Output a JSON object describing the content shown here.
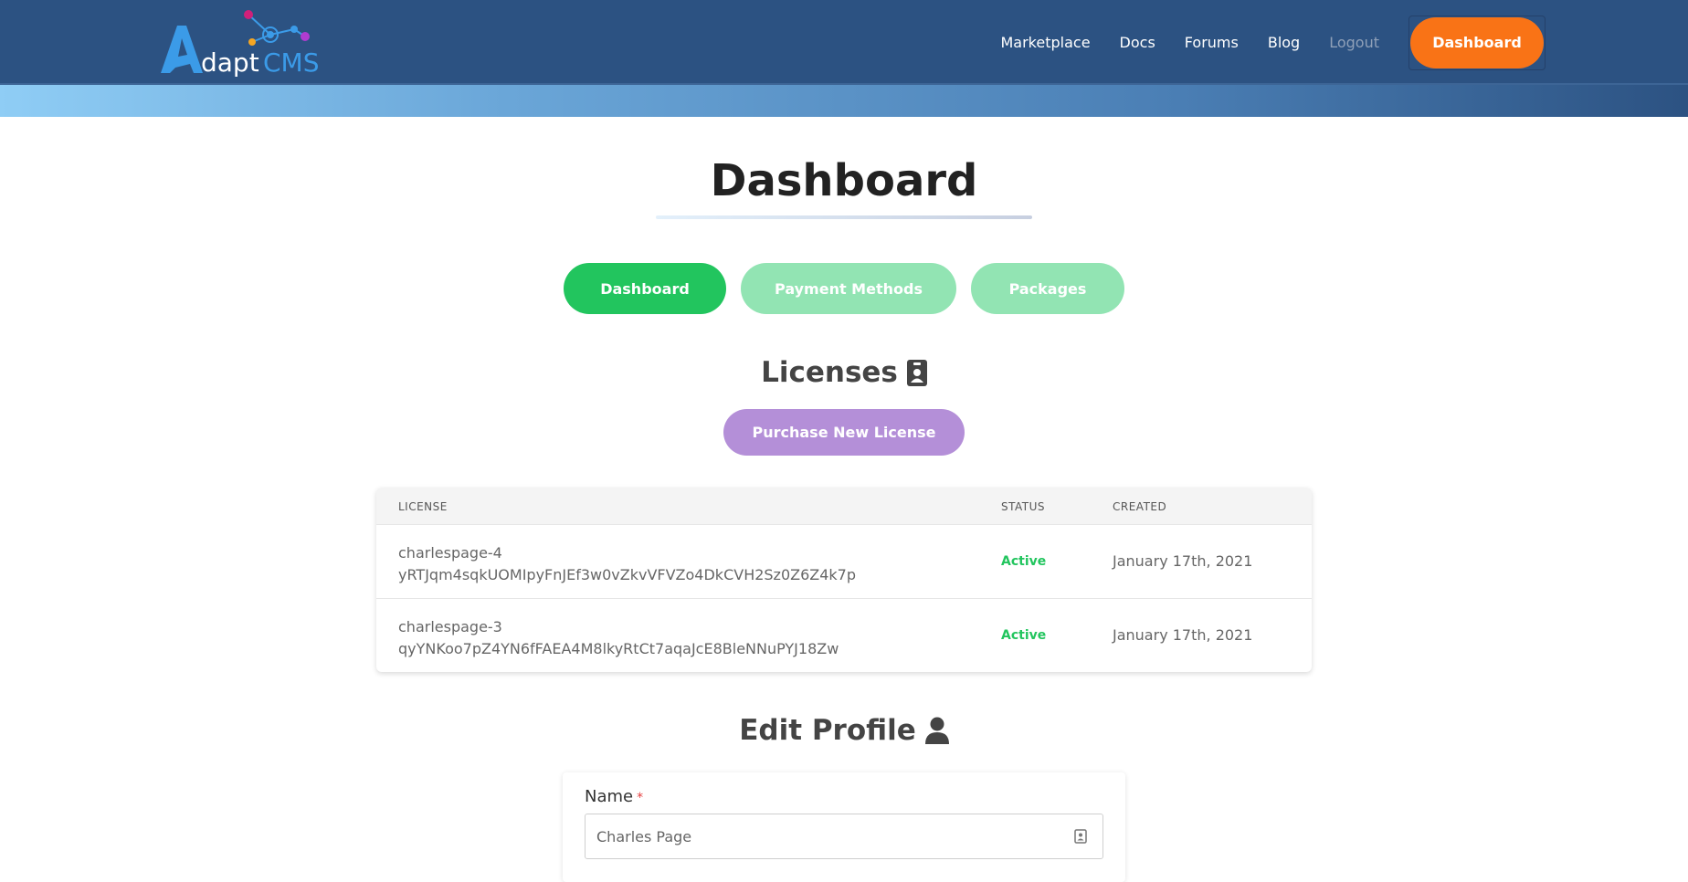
{
  "header": {
    "logo_text": "AdaptCMS",
    "nav": [
      {
        "label": "Marketplace"
      },
      {
        "label": "Docs"
      },
      {
        "label": "Forums"
      },
      {
        "label": "Blog"
      },
      {
        "label": "Logout"
      }
    ],
    "cta_label": "Dashboard"
  },
  "page": {
    "title": "Dashboard"
  },
  "tabs": [
    {
      "label": "Dashboard",
      "active": true
    },
    {
      "label": "Payment Methods",
      "active": false
    },
    {
      "label": "Packages",
      "active": false
    }
  ],
  "licenses": {
    "title": "Licenses",
    "icon": "id-badge-icon",
    "purchase_label": "Purchase New License",
    "columns": [
      "LICENSE",
      "STATUS",
      "CREATED"
    ],
    "rows": [
      {
        "name": "charlespage-4",
        "key": "yRTJqm4sqkUOMIpyFnJEf3w0vZkvVFVZo4DkCVH2Sz0Z6Z4k7p",
        "status": "Active",
        "created": "January 17th, 2021"
      },
      {
        "name": "charlespage-3",
        "key": "qyYNKoo7pZ4YN6fFAEA4M8lkyRtCt7aqaJcE8BleNNuPYJ18Zw",
        "status": "Active",
        "created": "January 17th, 2021"
      }
    ]
  },
  "profile": {
    "title": "Edit Profile",
    "icon": "user-icon",
    "name_label": "Name",
    "required_mark": "*",
    "name_value": "Charles Page"
  },
  "colors": {
    "header_bg": "#2c5282",
    "cta": "#f97316",
    "tab_active": "#22c55e",
    "tab_inactive": "#92e4b3",
    "purchase": "#b48fd8",
    "status_active": "#22c55e"
  }
}
